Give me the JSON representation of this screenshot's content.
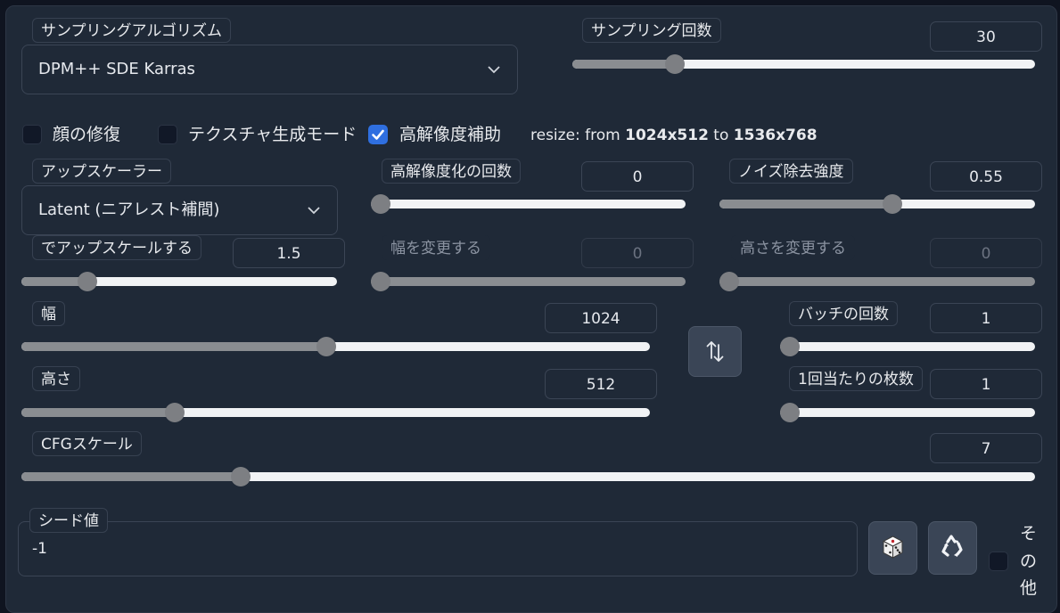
{
  "sampler": {
    "label": "サンプリングアルゴリズム",
    "value": "DPM++ SDE Karras"
  },
  "steps": {
    "label": "サンプリング回数",
    "value": "30",
    "fraction": 0.21
  },
  "restore_faces": {
    "label": "顔の修復",
    "checked": false
  },
  "tiling": {
    "label": "テクスチャ生成モード",
    "checked": false
  },
  "hires_fix": {
    "label": "高解像度補助",
    "checked": true,
    "resize_prefix": "resize: from ",
    "from_size": "1024x512",
    "to_word": " to ",
    "to_size": "1536x768"
  },
  "upscaler": {
    "label": "アップスケーラー",
    "value": "Latent (ニアレスト補間)"
  },
  "hires_steps": {
    "label": "高解像度化の回数",
    "value": "0",
    "fraction": 0.0
  },
  "denoising": {
    "label": "ノイズ除去強度",
    "value": "0.55",
    "fraction": 0.55
  },
  "upscale_by": {
    "label": "でアップスケールする",
    "value": "1.5",
    "fraction": 0.19
  },
  "resize_width": {
    "label": "幅を変更する",
    "value": "0",
    "fraction": 0.0
  },
  "resize_height": {
    "label": "高さを変更する",
    "value": "0",
    "fraction": 0.0
  },
  "width": {
    "label": "幅",
    "value": "1024",
    "fraction": 0.485
  },
  "height": {
    "label": "高さ",
    "value": "512",
    "fraction": 0.235
  },
  "swap_button": {
    "icon": "swap-arrows-icon"
  },
  "batch_count": {
    "label": "バッチの回数",
    "value": "1",
    "fraction": 0.0
  },
  "batch_size": {
    "label": "1回当たりの枚数",
    "value": "1",
    "fraction": 0.0
  },
  "cfg_scale": {
    "label": "CFGスケール",
    "value": "7",
    "fraction": 0.211
  },
  "seed": {
    "label": "シード値",
    "value": "-1"
  },
  "seed_buttons": {
    "random_icon": "dice-icon",
    "reuse_icon": "recycle-icon"
  },
  "extra": {
    "label_chars": [
      "そ",
      "の",
      "他"
    ],
    "checked": false
  }
}
